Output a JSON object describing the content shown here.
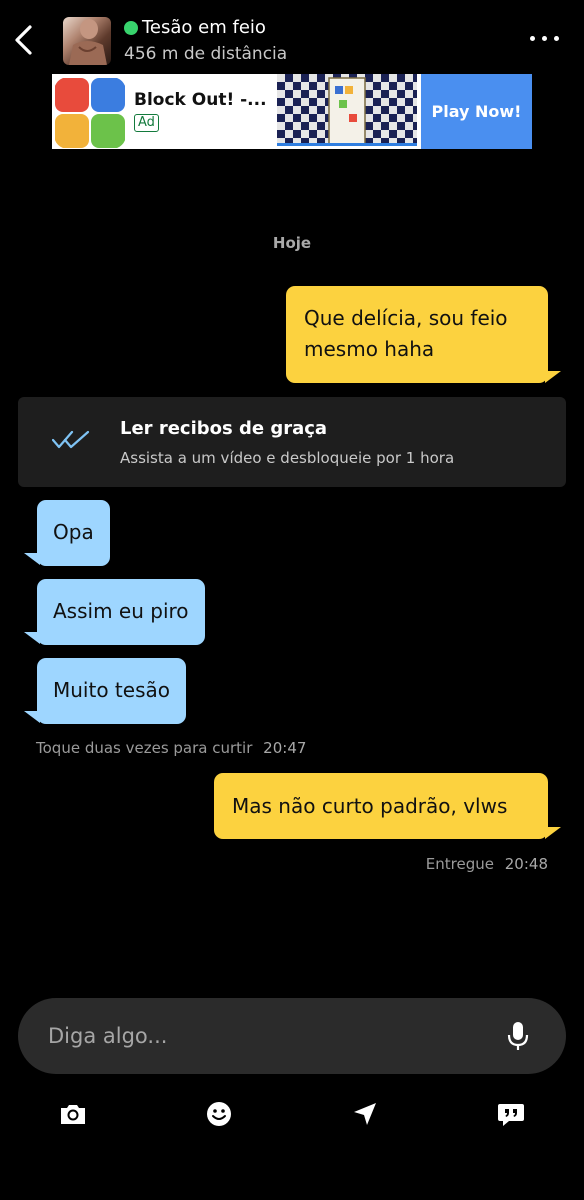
{
  "header": {
    "name": "Tesão em feio",
    "distance": "456 m de distância",
    "status_color": "#38d36d"
  },
  "ad": {
    "title": "Block Out! -...",
    "badge": "Ad",
    "cta": "Play Now!"
  },
  "chat": {
    "day_label": "Hoje",
    "messages": [
      {
        "from": "me",
        "lines": [
          "Que delícia, sou feio",
          "mesmo haha"
        ]
      },
      {
        "from": "them",
        "text": "Opa"
      },
      {
        "from": "them",
        "text": "Assim eu piro"
      },
      {
        "from": "them",
        "text": "Muito tesão"
      },
      {
        "from": "me",
        "text": "Mas não curto padrão, vlws"
      }
    ],
    "receipts_promo": {
      "title": "Ler recibos de graça",
      "subtitle": "Assista a um vídeo e desbloqueie por 1 hora"
    },
    "their_meta": {
      "hint": "Toque duas vezes para curtir",
      "time": "20:47"
    },
    "my_meta": {
      "status": "Entregue",
      "time": "20:48"
    }
  },
  "composer": {
    "placeholder": "Diga algo...",
    "icons": [
      "camera-icon",
      "emoji-icon",
      "location-icon",
      "quick-reply-icon",
      "mic-icon"
    ]
  },
  "colors": {
    "outgoing_bubble": "#fcd23f",
    "incoming_bubble": "#9ed6ff",
    "receipts_check": "#7fc3f4"
  }
}
